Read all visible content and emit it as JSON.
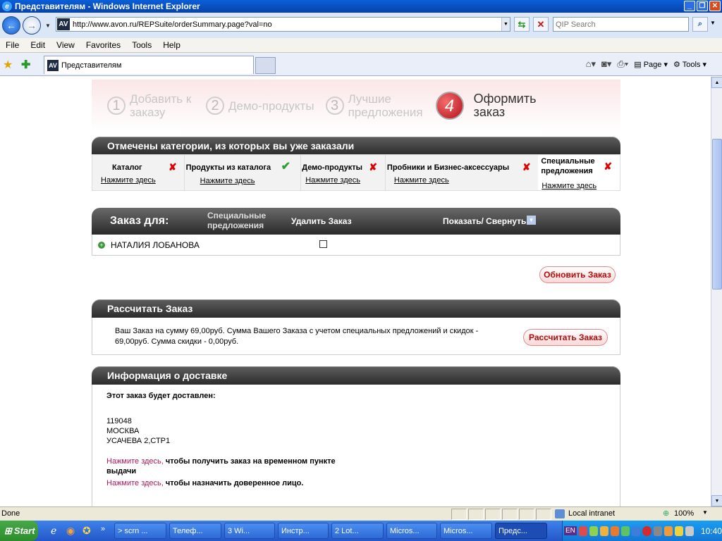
{
  "window": {
    "title": "Представителям - Windows Internet Explorer"
  },
  "toolbar": {
    "url": "http://www.avon.ru/REPSuite/orderSummary.page?val=no",
    "search_placeholder": "QIP Search",
    "site_logo": "AV"
  },
  "menu": [
    "File",
    "Edit",
    "View",
    "Favorites",
    "Tools",
    "Help"
  ],
  "tab": {
    "title": "Представителям"
  },
  "command_bar": {
    "page_label": "Page",
    "tools_label": "Tools"
  },
  "steps": [
    {
      "num": "1",
      "label": "Добавить к заказу"
    },
    {
      "num": "2",
      "label": "Демо-продукты"
    },
    {
      "num": "3",
      "label": "Лучшие предложения"
    },
    {
      "num": "4",
      "label": "Оформить заказ"
    }
  ],
  "categories": {
    "header": "Отмечены категории, из которых вы уже заказали",
    "link_text": "Нажмите здесь",
    "items": [
      {
        "label": "Каталог",
        "status": "x"
      },
      {
        "label": "Продукты из каталога",
        "status": "check"
      },
      {
        "label": "Демо-продукты",
        "status": "x"
      },
      {
        "label": "Пробники и Бизнес-аксессуары",
        "status": "x"
      },
      {
        "label": "Специальные предложения",
        "status": "x"
      }
    ]
  },
  "order": {
    "header_for": "Заказ для:",
    "header_special": "Специальные предложения",
    "header_delete": "Удалить Заказ",
    "header_toggle": "Показать/ Свернуть",
    "customer": "НАТАЛИЯ ЛОБАНОВА",
    "update_button": "Обновить Заказ"
  },
  "calculate": {
    "header": "Рассчитать Заказ",
    "summary": "Ваш Заказ на сумму 69,00руб. Сумма Вашего Заказа с учетом специальных предложений и скидок - 69,00руб. Сумма скидки - 0,00руб.",
    "button": "Рассчитать Заказ"
  },
  "delivery": {
    "header": "Информация о доставке",
    "intro": "Этот заказ будет доставлен:",
    "postcode": "119048",
    "city": "МОСКВА",
    "street": "УСАЧЕВА 2,СТР1",
    "link1": "Нажмите здесь,",
    "link1_text": "чтобы получить заказ на временном пункте выдачи",
    "link2": "Нажмите здесь,",
    "link2_text": "чтобы назначить доверенное лицо."
  },
  "status": {
    "left": "Done",
    "zone": "Local intranet",
    "zoom": "100%"
  },
  "taskbar": {
    "start": "Start",
    "lang": "EN",
    "clock": "10:40",
    "items": [
      "> scrn ...",
      "Телеф...",
      "3 Wi...",
      "Инстр...",
      "2 Lot...",
      "Micros...",
      "Micros...",
      "Предс..."
    ]
  },
  "colors": {
    "accent_red": "#d00000",
    "link_magenta": "#b0165e",
    "check_green": "#2aa12a"
  }
}
